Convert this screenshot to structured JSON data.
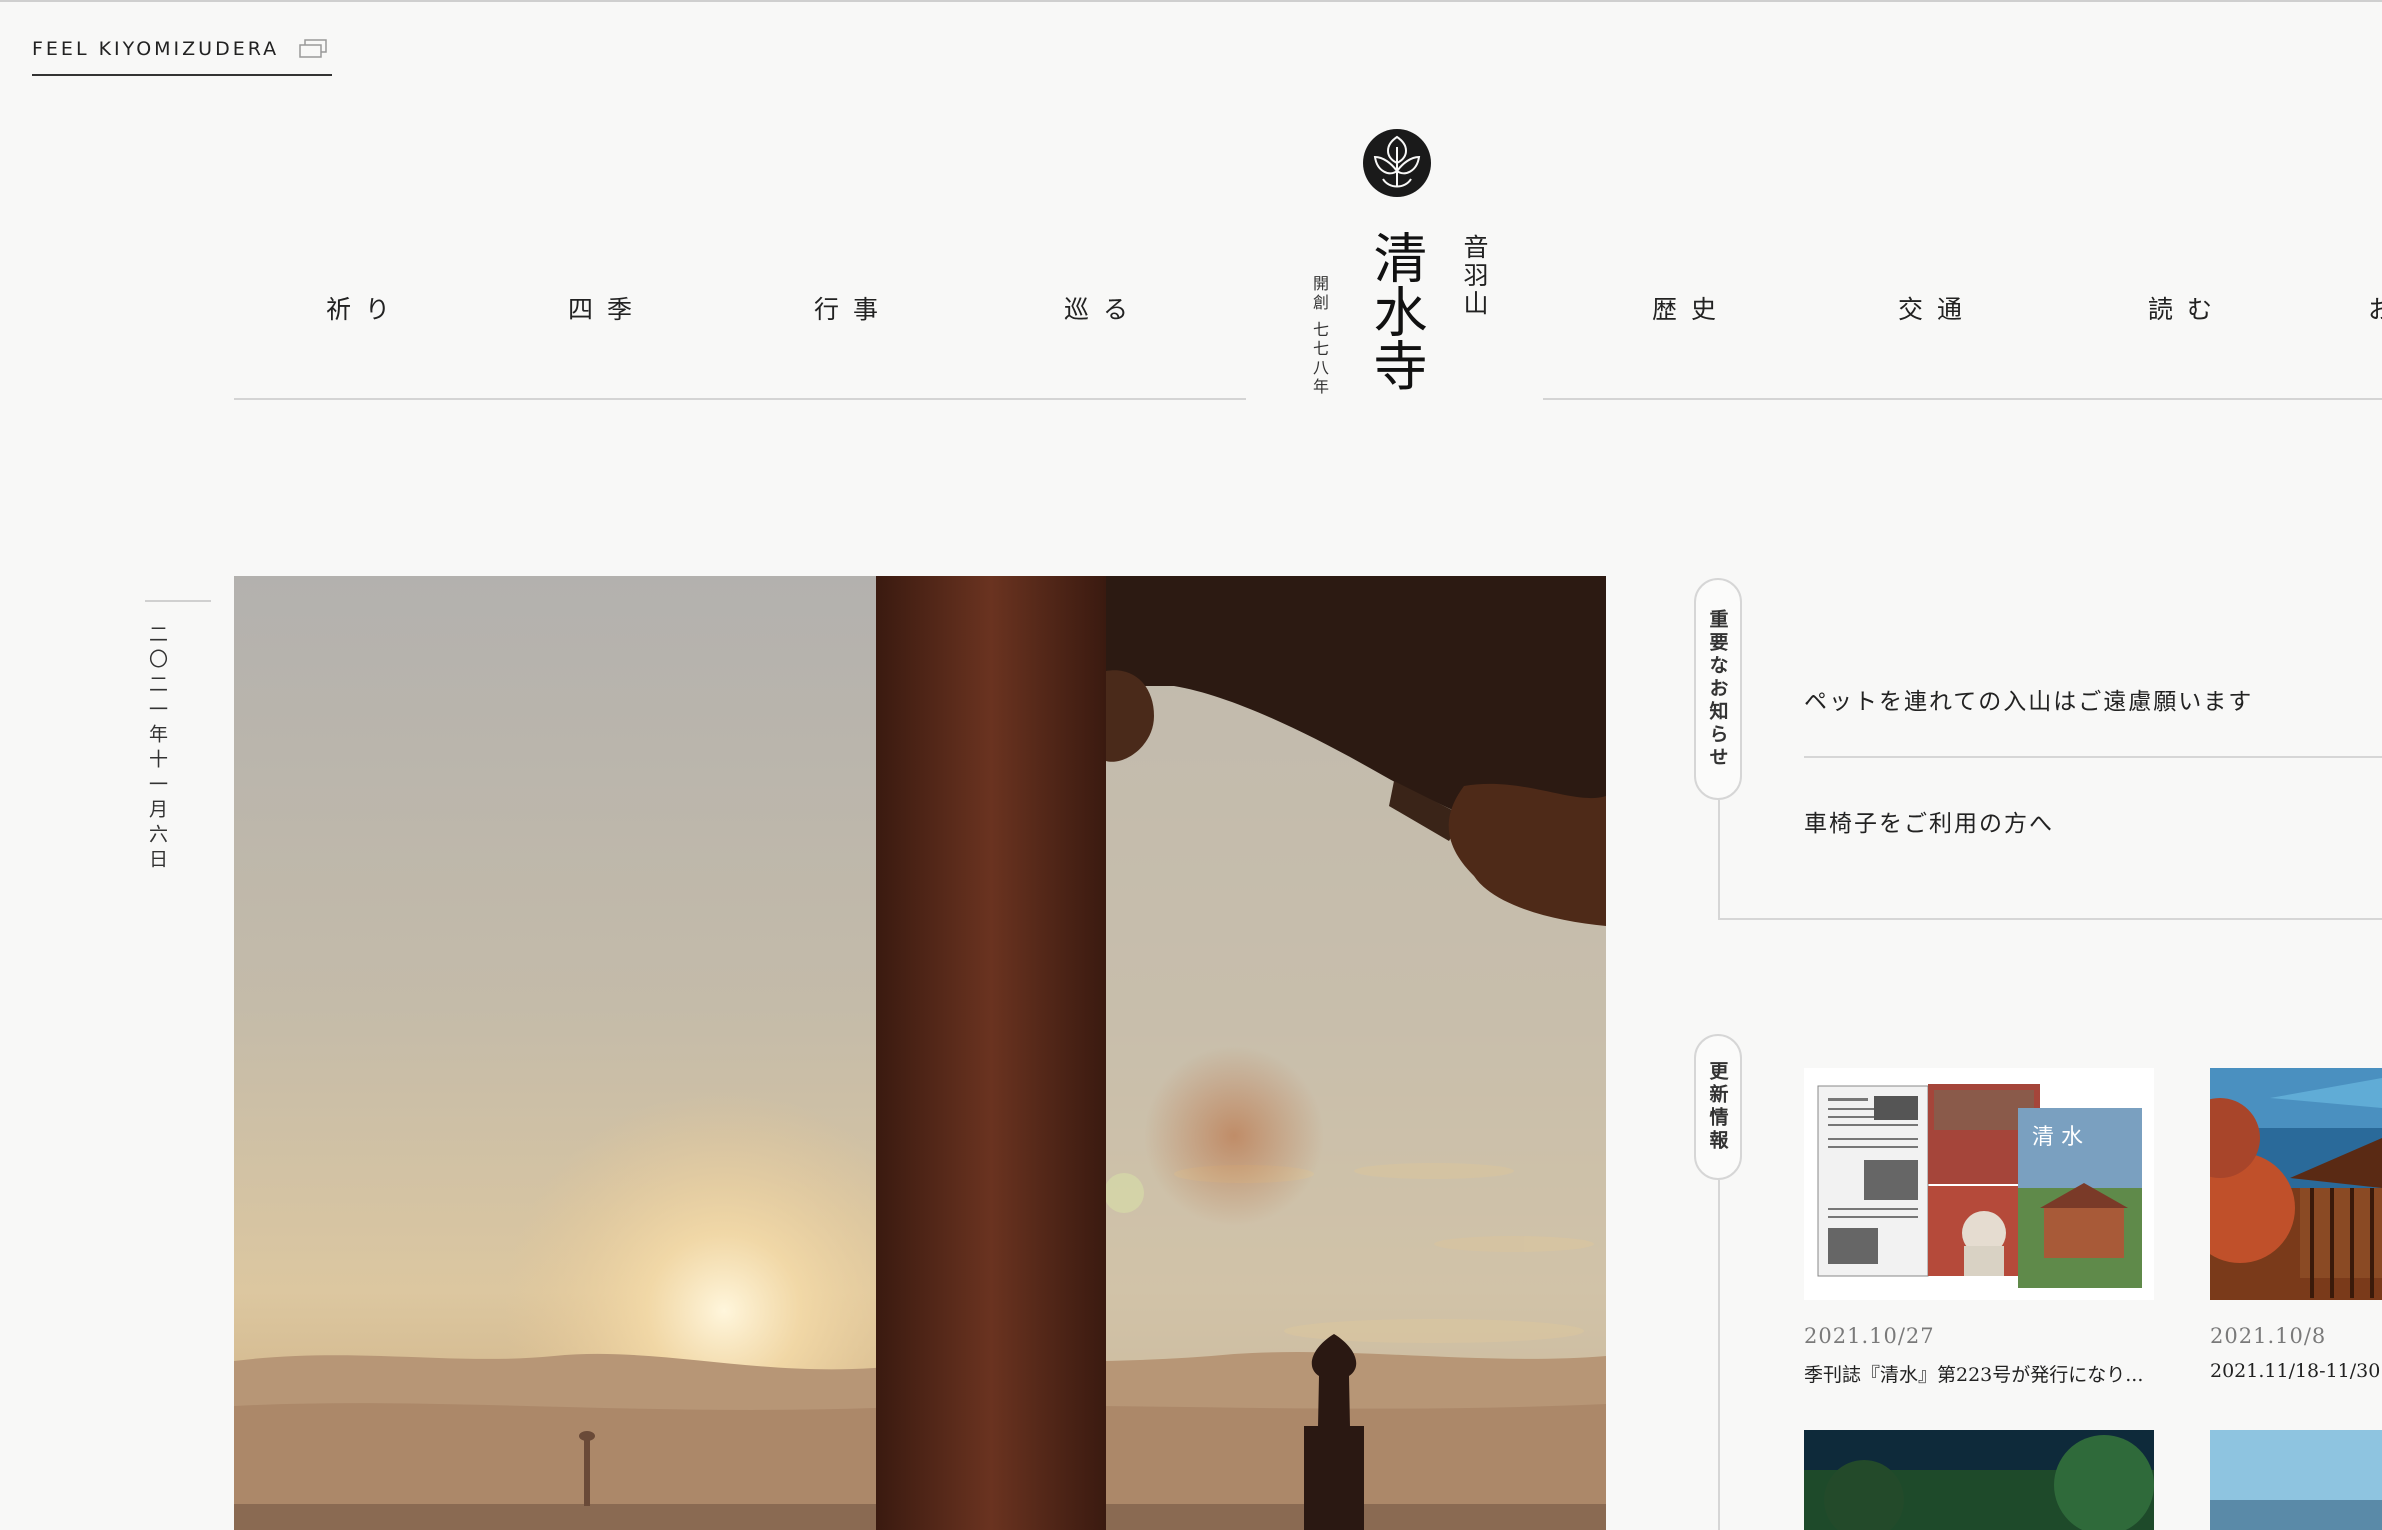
{
  "brand": {
    "feel_link": "FEEL KIYOMIZUDERA",
    "mountain": "音羽山",
    "name": "清水寺",
    "founding": "開創 七七八年"
  },
  "nav": {
    "left": [
      "祈り",
      "四季",
      "行事",
      "巡る"
    ],
    "right": [
      "歴史",
      "交通",
      "読む",
      "お"
    ]
  },
  "date": "二〇二一年十一月六日",
  "notices": {
    "heading": "重要なお知らせ",
    "items": [
      "ペットを連れての入山はご遠慮願います",
      "車椅子をご利用の方へ"
    ]
  },
  "updates": {
    "heading": "更新情報",
    "items": [
      {
        "date": "2021.10/27",
        "title": "季刊誌『清水』第223号が発行になり..."
      },
      {
        "date": "2021.10/8",
        "title": "2021.11/18-11/30"
      }
    ],
    "magazine_cover_text": "清 水"
  },
  "colors": {
    "accent": "#222222",
    "background": "#f8f8f7",
    "hero_sky": "#c9bba4",
    "hero_pillar": "#5a2a18"
  }
}
